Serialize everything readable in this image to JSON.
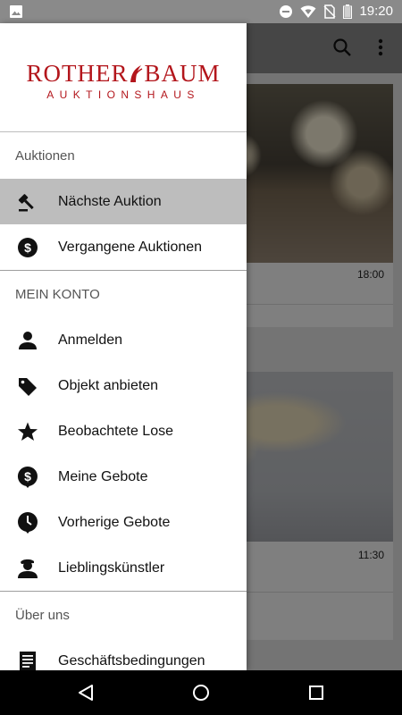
{
  "status_bar": {
    "time": "19:20",
    "icons": [
      "image-icon",
      "do-not-disturb-icon",
      "wifi-icon",
      "no-sim-icon",
      "battery-icon"
    ]
  },
  "background_app": {
    "cards": [
      {
        "time": "18:00"
      },
      {
        "time": "11:30"
      }
    ]
  },
  "drawer": {
    "logo": {
      "main_left": "ROTHER",
      "main_right": "BAUM",
      "sub": "AUKTIONSHAUS"
    },
    "sections": [
      {
        "title": "Auktionen",
        "items": [
          {
            "label": "Nächste Auktion",
            "icon": "gavel-icon",
            "active": true
          },
          {
            "label": "Vergangene Auktionen",
            "icon": "dollar-circle-icon"
          }
        ]
      },
      {
        "title": "MEIN KONTO",
        "items": [
          {
            "label": "Anmelden",
            "icon": "person-icon"
          },
          {
            "label": "Objekt anbieten",
            "icon": "tag-icon"
          },
          {
            "label": "Beobachtete Lose",
            "icon": "star-icon"
          },
          {
            "label": "Meine Gebote",
            "icon": "dollar-pin-icon"
          },
          {
            "label": "Vorherige Gebote",
            "icon": "clock-pin-icon"
          },
          {
            "label": "Lieblingskünstler",
            "icon": "artist-icon"
          }
        ]
      },
      {
        "title": "Über uns",
        "items": [
          {
            "label": "Geschäftsbedingungen",
            "icon": "document-icon"
          }
        ]
      }
    ]
  },
  "colors": {
    "brand_red": "#b3161c",
    "active_item_bg": "#bdbdbd",
    "scrim": "rgba(0,0,0,0.5)"
  }
}
